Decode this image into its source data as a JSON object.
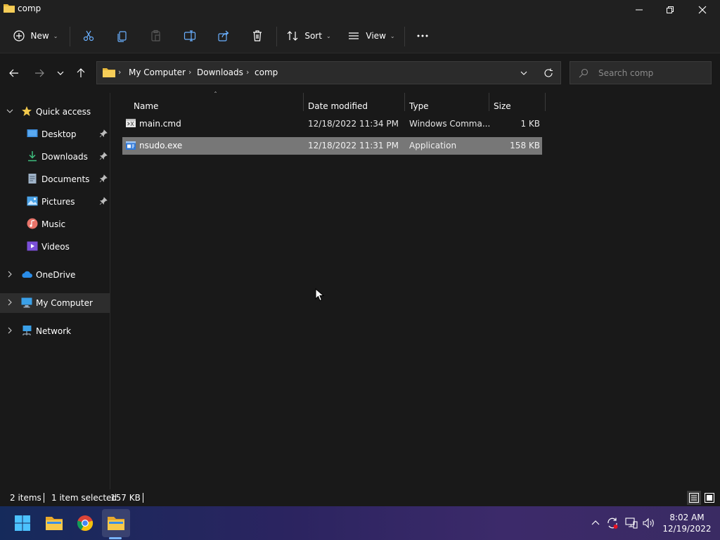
{
  "window": {
    "title": "comp"
  },
  "toolbar": {
    "new_label": "New",
    "sort_label": "Sort",
    "view_label": "View"
  },
  "address": {
    "crumbs": [
      "My Computer",
      "Downloads",
      "comp"
    ]
  },
  "search": {
    "placeholder": "Search comp"
  },
  "sidebar": {
    "items": [
      {
        "label": "Quick access",
        "icon": "star-icon"
      },
      {
        "label": "Desktop",
        "icon": "desktop-icon",
        "pinned": true
      },
      {
        "label": "Downloads",
        "icon": "download-icon",
        "pinned": true
      },
      {
        "label": "Documents",
        "icon": "documents-icon",
        "pinned": true
      },
      {
        "label": "Pictures",
        "icon": "pictures-icon",
        "pinned": true
      },
      {
        "label": "Music",
        "icon": "music-icon"
      },
      {
        "label": "Videos",
        "icon": "videos-icon"
      },
      {
        "label": "OneDrive",
        "icon": "cloud-icon"
      },
      {
        "label": "My Computer",
        "icon": "computer-icon",
        "selected": true
      },
      {
        "label": "Network",
        "icon": "network-icon"
      }
    ]
  },
  "files": {
    "columns": [
      "Name",
      "Date modified",
      "Type",
      "Size"
    ],
    "rows": [
      {
        "name": "main.cmd",
        "date": "12/18/2022 11:34 PM",
        "type": "Windows Comma...",
        "size": "1 KB",
        "icon": "cmd-file-icon"
      },
      {
        "name": "nsudo.exe",
        "date": "12/18/2022 11:31 PM",
        "type": "Application",
        "size": "158 KB",
        "icon": "exe-file-icon",
        "selected": true
      }
    ]
  },
  "status": {
    "items_count": "2 items",
    "selection": "1 item selected",
    "selection_size": "157 KB"
  },
  "taskbar": {
    "apps": [
      "start-icon",
      "file-explorer-icon",
      "chrome-icon",
      "file-explorer-active-icon"
    ]
  },
  "clock": {
    "time": "8:02 AM",
    "date": "12/19/2022"
  },
  "colors": {
    "background": "#191919",
    "selected_row": "#777777",
    "accent": "#78b4ff",
    "folder": "#f2c94c"
  }
}
